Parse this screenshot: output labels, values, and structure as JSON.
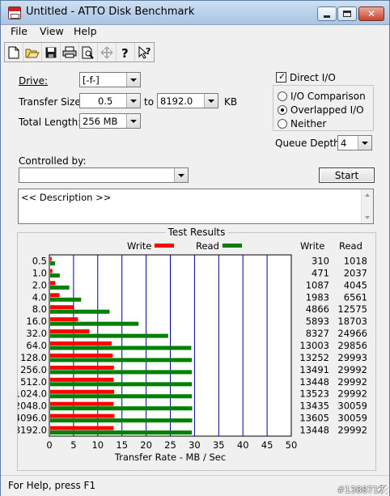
{
  "window": {
    "title": "Untitled - ATTO Disk Benchmark",
    "close_label": "✕"
  },
  "menu": [
    "File",
    "View",
    "Help"
  ],
  "toolbar": {
    "icons": [
      "new-document-icon",
      "open-folder-icon",
      "save-icon",
      "print-icon",
      "print-preview-icon",
      "move-icon",
      "help-icon",
      "context-help-icon"
    ]
  },
  "form": {
    "drive_label": "Drive:",
    "drive_value": "[-f-]",
    "transfer_size_label": "Transfer Size:",
    "transfer_from": "0.5",
    "to_label": "to",
    "transfer_to": "8192.0",
    "kb_label": "KB",
    "total_length_label": "Total Length:",
    "total_length_value": "256 MB",
    "direct_io_label": "Direct I/O",
    "direct_io_checked": true,
    "io_comparison_label": "I/O Comparison",
    "overlapped_io_label": "Overlapped I/O",
    "neither_label": "Neither",
    "selected_mode": "Overlapped I/O",
    "queue_depth_label": "Queue Depth:",
    "queue_depth_value": "4",
    "controlled_by_label": "Controlled by:",
    "controlled_by_value": "",
    "start_label": "Start",
    "description_text": "<< Description >>"
  },
  "results": {
    "title": "Test Results",
    "write_col": "Write",
    "read_col": "Read"
  },
  "chart_data": {
    "type": "bar",
    "orientation": "horizontal",
    "categories": [
      "0.5",
      "1.0",
      "2.0",
      "4.0",
      "8.0",
      "16.0",
      "32.0",
      "64.0",
      "128.0",
      "256.0",
      "512.0",
      "1024.0",
      "2048.0",
      "4096.0",
      "8192.0"
    ],
    "series": [
      {
        "name": "Write",
        "color": "#ff0000",
        "values": [
          310,
          471,
          1087,
          1983,
          4866,
          5893,
          8327,
          13003,
          13252,
          13491,
          13448,
          13523,
          13435,
          13605,
          13448
        ]
      },
      {
        "name": "Read",
        "color": "#008000",
        "values": [
          1018,
          2037,
          4045,
          6561,
          12575,
          18703,
          24966,
          29856,
          29993,
          29992,
          29992,
          29992,
          30059,
          30059,
          29992
        ]
      }
    ],
    "xlabel": "Transfer Rate - MB / Sec",
    "xlim": [
      0,
      50
    ],
    "xticks": [
      "0",
      "5",
      "10",
      "15",
      "20",
      "25",
      "30",
      "35",
      "40",
      "45",
      "50"
    ],
    "grid": true,
    "legend": "top"
  },
  "status": {
    "text": "For Help, press F1",
    "watermark": "#1388717"
  }
}
